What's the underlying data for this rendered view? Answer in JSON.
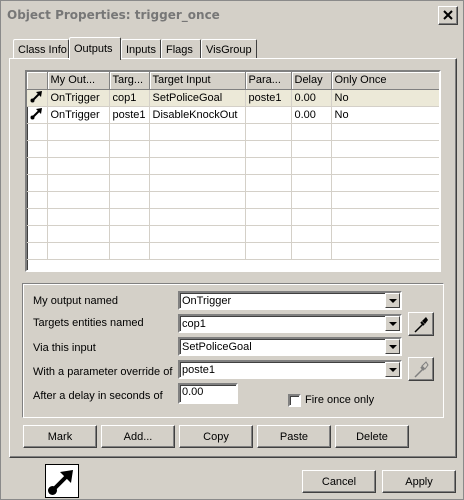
{
  "window": {
    "title": "Object Properties: trigger_once"
  },
  "tabs": [
    {
      "label": "Class Info",
      "active": false
    },
    {
      "label": "Outputs",
      "active": true
    },
    {
      "label": "Inputs",
      "active": false
    },
    {
      "label": "Flags",
      "active": false
    },
    {
      "label": "VisGroup",
      "active": false
    }
  ],
  "outputs_list": {
    "columns": [
      "My Out...",
      "Targ...",
      "Target Input",
      "Para...",
      "Delay",
      "Only Once"
    ],
    "rows": [
      {
        "icon": "output-connection-icon",
        "output": "OnTrigger",
        "target": "cop1",
        "input": "SetPoliceGoal",
        "param": "poste1",
        "delay": "0.00",
        "once": "No",
        "selected": true
      },
      {
        "icon": "output-connection-icon",
        "output": "OnTrigger",
        "target": "poste1",
        "input": "DisableKnockOut",
        "param": "",
        "delay": "0.00",
        "once": "No",
        "selected": false
      }
    ]
  },
  "form": {
    "output_label": "My output named",
    "output_value": "OnTrigger",
    "targets_label": "Targets entities named",
    "targets_value": "cop1",
    "input_label": "Via this input",
    "input_value": "SetPoliceGoal",
    "param_label": "With a parameter override of",
    "param_value": "poste1",
    "delay_label": "After a delay in seconds of",
    "delay_value": "0.00",
    "fire_once_label": "Fire once only",
    "fire_once_checked": false
  },
  "actions": {
    "mark": "Mark",
    "add": "Add...",
    "copy": "Copy",
    "paste": "Paste",
    "delete": "Delete"
  },
  "footer": {
    "cancel": "Cancel",
    "apply": "Apply"
  }
}
